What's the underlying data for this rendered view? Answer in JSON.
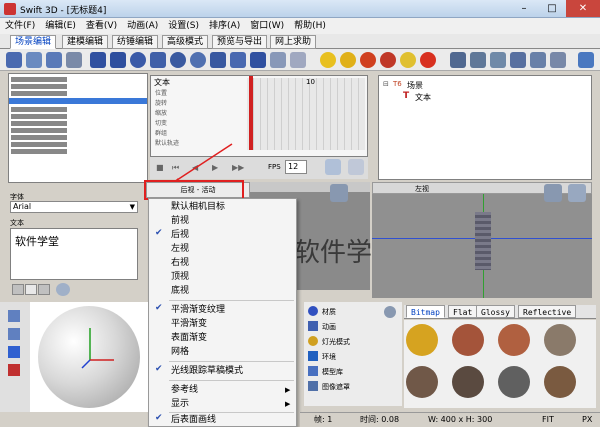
{
  "window": {
    "title": "Swift 3D - [无标题4]",
    "minimize": "–",
    "maximize": "□",
    "close": "✕"
  },
  "menubar": [
    "文件(F)",
    "编辑(E)",
    "查看(V)",
    "动画(A)",
    "设置(S)",
    "排序(A)",
    "窗口(W)",
    "帮助(H)"
  ],
  "tabs": [
    "场景编辑",
    "建模编辑",
    "纺锤编辑",
    "高级模式",
    "预览与导出",
    "网上求助"
  ],
  "timeline": {
    "title": "文本",
    "rows": [
      "位置",
      "旋转",
      "缩放",
      "切变",
      "群组",
      "默认轨迹"
    ],
    "marker": "10",
    "fps_label": "FPS",
    "fps_value": "12"
  },
  "hierarchy": {
    "root": "场景",
    "child": "文本"
  },
  "font": {
    "label": "字体",
    "value": "Arial"
  },
  "text": {
    "label": "文本",
    "value": "软件学堂"
  },
  "viewport_left": {
    "title": "后视 - 活动",
    "preview_text": "软件学堂"
  },
  "viewport_right": {
    "title": "左视"
  },
  "context_menu": {
    "items": [
      {
        "label": "默认相机目标",
        "checked": false,
        "submenu": false
      },
      {
        "label": "前视",
        "checked": false,
        "submenu": false
      },
      {
        "label": "后视",
        "checked": true,
        "submenu": false
      },
      {
        "label": "左视",
        "checked": false,
        "submenu": false
      },
      {
        "label": "右视",
        "checked": false,
        "submenu": false
      },
      {
        "label": "顶视",
        "checked": false,
        "submenu": false
      },
      {
        "label": "底视",
        "checked": false,
        "submenu": false
      },
      {
        "label": "平滑渐变纹理",
        "checked": true,
        "submenu": false
      },
      {
        "label": "平滑渐变",
        "checked": false,
        "submenu": false
      },
      {
        "label": "表面渐变",
        "checked": false,
        "submenu": false
      },
      {
        "label": "网格",
        "checked": false,
        "submenu": false
      },
      {
        "label": "光线跟踪草稿模式",
        "checked": true,
        "submenu": false
      },
      {
        "label": "参考线",
        "checked": false,
        "submenu": true
      },
      {
        "label": "显示",
        "checked": false,
        "submenu": true
      },
      {
        "label": "后表面画线",
        "checked": true,
        "submenu": false
      }
    ]
  },
  "material_tabs": [
    "Bitmap",
    "Flat",
    "Glossy",
    "Reflective"
  ],
  "material_props": [
    "材质",
    "动画",
    "灯光模式",
    "环境",
    "模型库",
    "图像遮罩"
  ],
  "material_colors": [
    "#d6a320",
    "#a4543a",
    "#b06040",
    "#8a7a6a",
    "#705848",
    "#5a4a40",
    "#606060",
    "#7a5a40"
  ],
  "statusbar": {
    "frame": "帧: 1",
    "time": "时间: 0.08",
    "size": "W: 400 x H: 300",
    "fit": "FIT",
    "px": "PX"
  }
}
